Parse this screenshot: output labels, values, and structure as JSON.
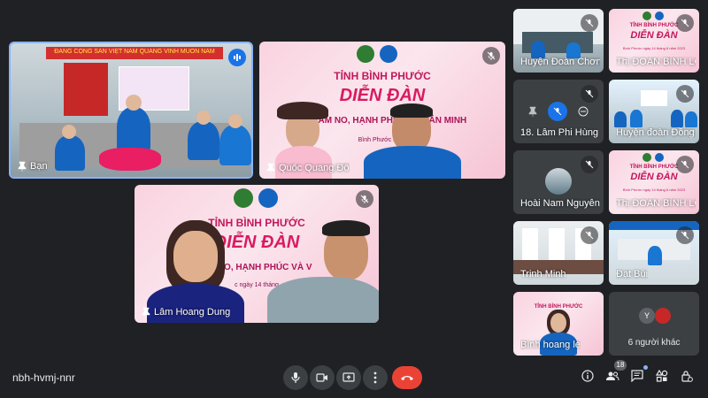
{
  "meeting": {
    "code": "nbh-hvmj-nnr",
    "participant_count": "18"
  },
  "main_tiles": [
    {
      "name": "Bạn",
      "banner_text": "ĐẢNG CỘNG SẢN VIỆT NAM QUANG VINH MUÔN NĂM"
    },
    {
      "name": "Quốc Quang Đỗ",
      "province": "TỈNH BÌNH PHƯỚC",
      "title": "DIỄN ĐÀN",
      "subtitle": "TRẺ ẤM NO, HẠNH PHÚC VÀ VĂN MINH",
      "caption": "Bình Phước ngày"
    },
    {
      "name": "Lâm Hoang Dung",
      "province": "TỈNH BÌNH PHƯỚC",
      "title": "DIỄN ĐÀN",
      "subtitle": "ẤM NO, HẠNH PHÚC VÀ V",
      "caption": "c ngày 14 tháng"
    }
  ],
  "side_tiles": [
    {
      "name": "Huyện Đoàn Chơn T..."
    },
    {
      "name": "Thị ĐOÀN BÌNH LO...",
      "province": "TỈNH BÌNH PHƯỚC",
      "title": "DIỄN ĐÀN",
      "caption": "Bình Phước ngày 14 tháng 6 năm 2023"
    },
    {
      "name": "18. Lâm Phi Hùng"
    },
    {
      "name": "Huyện đoàn Đồng P..."
    },
    {
      "name": "Hoài Nam Nguyễn"
    },
    {
      "name": "Thị ĐOÀN BÌNH LO...",
      "province": "TỈNH BÌNH PHƯỚC",
      "title": "DIỄN ĐÀN",
      "caption": "Bình Phước ngày 14 tháng 6 năm 2023"
    },
    {
      "name": "Trịnh Minh"
    },
    {
      "name": "Đạt Bùi"
    },
    {
      "name": "Bình hoang le",
      "province": "TỈNH BÌNH PHƯỚC"
    },
    {
      "name": "6 người khác",
      "avatar_letter": "Y"
    }
  ],
  "icons": {
    "mic": "mic-icon",
    "camera": "camera-icon",
    "present": "present-screen-icon",
    "more": "more-vert-icon",
    "end": "end-call-icon",
    "info": "info-icon",
    "people": "people-icon",
    "chat": "chat-icon",
    "activities": "activities-icon",
    "host": "host-controls-icon"
  },
  "colors": {
    "end_call": "#ea4335",
    "speaking": "#1a73e8",
    "background": "#202124"
  }
}
